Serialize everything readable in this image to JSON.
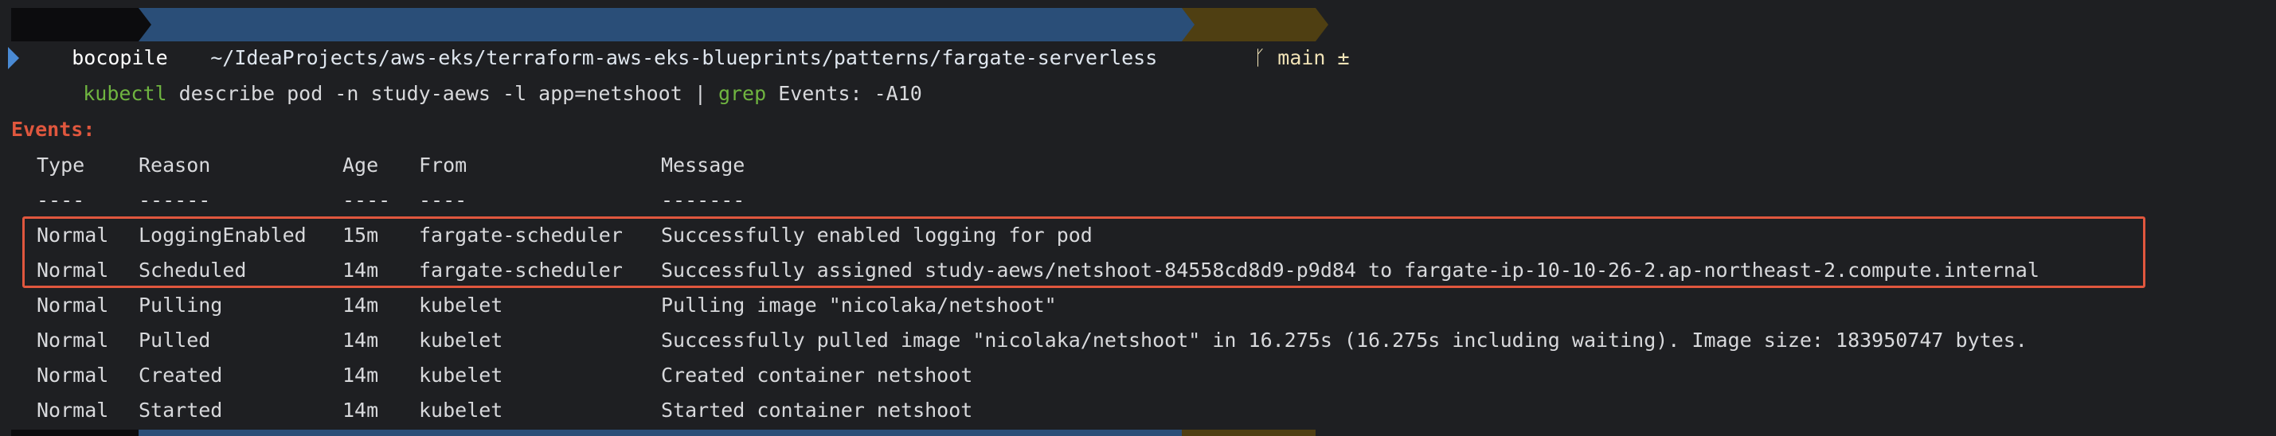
{
  "prompt": {
    "user": "bocopile",
    "path": "~/IdeaProjects/aws-eks/terraform-aws-eks-blueprints/patterns/fargate-serverless",
    "git_branch": "ᚴ main ±"
  },
  "command": {
    "part1": "kubectl",
    "part2": " describe pod -n study-aews -l app=netshoot | ",
    "part3": "grep",
    "part4": " Events: -A10"
  },
  "events_label": "Events:",
  "table": {
    "headers": [
      "Type",
      "Reason",
      "Age",
      "From",
      "Message"
    ],
    "separators": [
      "----",
      "------",
      "----",
      "----",
      "-------"
    ],
    "rows": [
      [
        "Normal",
        "LoggingEnabled",
        "15m",
        "fargate-scheduler",
        "Successfully enabled logging for pod"
      ],
      [
        "Normal",
        "Scheduled",
        "14m",
        "fargate-scheduler",
        "Successfully assigned study-aews/netshoot-84558cd8d9-p9d84 to fargate-ip-10-10-26-2.ap-northeast-2.compute.internal"
      ],
      [
        "Normal",
        "Pulling",
        "14m",
        "kubelet",
        "Pulling image \"nicolaka/netshoot\""
      ],
      [
        "Normal",
        "Pulled",
        "14m",
        "kubelet",
        "Successfully pulled image \"nicolaka/netshoot\" in 16.275s (16.275s including waiting). Image size: 183950747 bytes."
      ],
      [
        "Normal",
        "Created",
        "14m",
        "kubelet",
        "Created container netshoot"
      ],
      [
        "Normal",
        "Started",
        "14m",
        "kubelet",
        "Started container netshoot"
      ]
    ]
  },
  "colors": {
    "background": "#1e1f22",
    "text": "#d8d9dc",
    "accent_red": "#e0573e",
    "command_green": "#6fb440",
    "path_segment": "#2a4e78",
    "git_segment": "#4f3f12"
  }
}
